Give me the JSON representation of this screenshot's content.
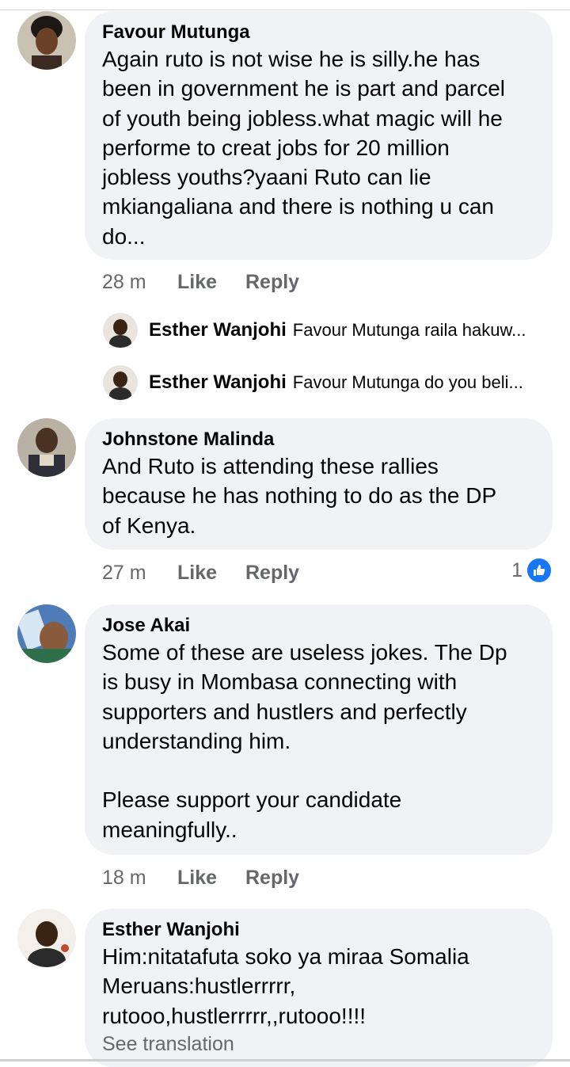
{
  "comments": [
    {
      "author": "Favour Mutunga",
      "text": "Again ruto is not wise he is silly.he has\nbeen in government he is part and parcel\nof youth being jobless.what magic will he\nperforme to creat jobs for 20 million\njobless youths?yaani Ruto can lie\nmkiangaliana and there is nothing u can\ndo...",
      "time": "28 m",
      "like_label": "Like",
      "reply_label": "Reply",
      "replies": [
        {
          "author": "Esther Wanjohi",
          "text": "Favour Mutunga raila hakuw..."
        },
        {
          "author": "Esther Wanjohi",
          "text": "Favour Mutunga do you beli..."
        }
      ]
    },
    {
      "author": "Johnstone Malinda",
      "text": "And Ruto is attending these rallies\nbecause he has nothing to do as the DP\nof Kenya.",
      "time": "27 m",
      "like_label": "Like",
      "reply_label": "Reply",
      "reaction_count": "1",
      "reaction_icon": "thumbs-up-icon"
    },
    {
      "author": "Jose Akai",
      "text": "Some of these are useless jokes. The Dp\nis busy in Mombasa connecting with\nsupporters and hustlers and perfectly\nunderstanding him.\n\nPlease support your candidate\nmeaningfully..",
      "time": "18 m",
      "like_label": "Like",
      "reply_label": "Reply"
    },
    {
      "author": "Esther Wanjohi",
      "text": "Him:nitatafuta soko ya miraa Somalia\nMeruans:hustlerrrrr,\nrutooo,hustlerrrrr,,rutooo!!!!",
      "see_translation": "See translation"
    }
  ],
  "colors": {
    "bubble": "#f0f2f5",
    "meta_text": "#65676b",
    "like_blue": "#1877f2"
  }
}
